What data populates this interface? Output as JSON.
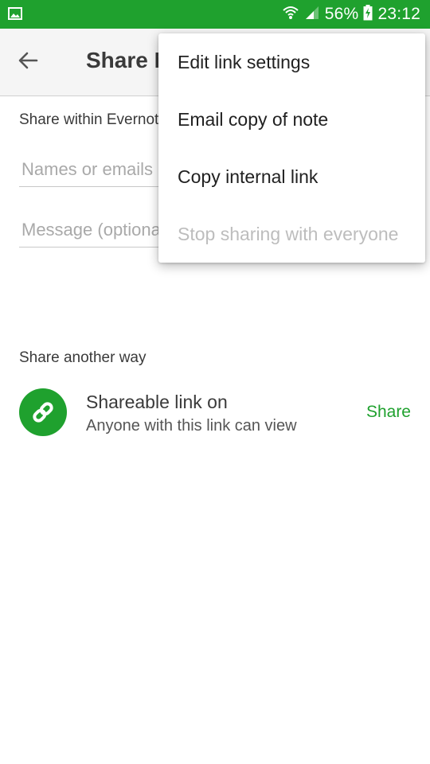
{
  "status_bar": {
    "battery": "56%",
    "time": "23:12",
    "icons": [
      "image-notification-icon",
      "wifi-icon",
      "signal-icon",
      "battery-charging-icon"
    ]
  },
  "app_bar": {
    "title": "Share Note",
    "back_icon": "arrow-back-icon"
  },
  "share_within": {
    "label": "Share within Evernote",
    "names_placeholder": "Names or emails",
    "message_placeholder": "Message (optional)"
  },
  "share_another": {
    "label": "Share another way",
    "link_title": "Shareable link on",
    "link_subtitle": "Anyone with this link can view",
    "share_label": "Share",
    "link_icon": "link-icon"
  },
  "overflow_menu": {
    "items": [
      {
        "label": "Edit link settings",
        "enabled": true
      },
      {
        "label": "Email copy of note",
        "enabled": true
      },
      {
        "label": "Copy internal link",
        "enabled": true
      },
      {
        "label": "Stop sharing with everyone",
        "enabled": false
      }
    ]
  },
  "colors": {
    "accent": "#1fa12e",
    "status_bar": "#1fa12e",
    "appbar": "#f5f5f5",
    "disabled_text": "#bdbdbd"
  }
}
